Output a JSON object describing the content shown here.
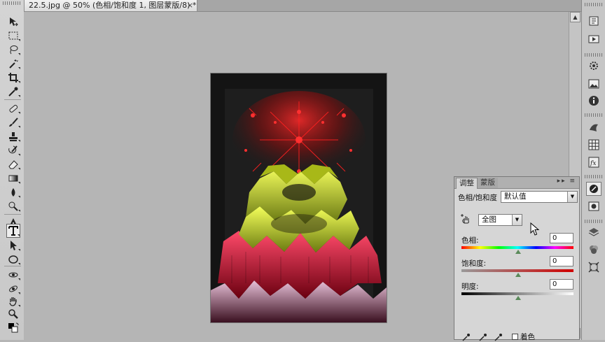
{
  "document_tab": {
    "title": "22.5.jpg @ 50% (色相/饱和度 1, 图层蒙版/8) *",
    "close": "×"
  },
  "panel": {
    "tabs": [
      "调整",
      "蒙版"
    ],
    "controls": "▸▸ ≡",
    "adjustment_name": "色相/饱和度",
    "preset_value": "默认值",
    "channel_value": "全图",
    "hue": {
      "label": "色相:",
      "value": "0"
    },
    "saturation": {
      "label": "饱和度:",
      "value": "0"
    },
    "lightness": {
      "label": "明度:",
      "value": "0"
    },
    "colorize_label": "着色"
  },
  "colors": {
    "accent_knob": "#5a8a5a",
    "canvas_bg": "#b5b5b5"
  },
  "icons": {
    "tools": [
      "move-icon",
      "marquee-icon",
      "lasso-icon",
      "magic-wand-icon",
      "crop-icon",
      "eyedropper-icon",
      "healing-brush-icon",
      "brush-icon",
      "clone-stamp-icon",
      "history-brush-icon",
      "eraser-icon",
      "gradient-icon",
      "blur-icon",
      "dodge-icon",
      "pen-icon",
      "type-icon",
      "path-selection-icon",
      "shape-icon",
      "3d-rotate-icon",
      "3d-orbit-icon",
      "hand-icon",
      "zoom-icon",
      "color-swatches-icon"
    ],
    "dock": [
      "history-icon",
      "actions-icon",
      "adjustments-icon",
      "navigator-icon",
      "info-icon",
      "styles-icon",
      "swatches-icon",
      "layers-fx-icon",
      "masks-icon",
      "paths-icon",
      "layers-icon",
      "channels-icon",
      "transform-icon"
    ]
  }
}
